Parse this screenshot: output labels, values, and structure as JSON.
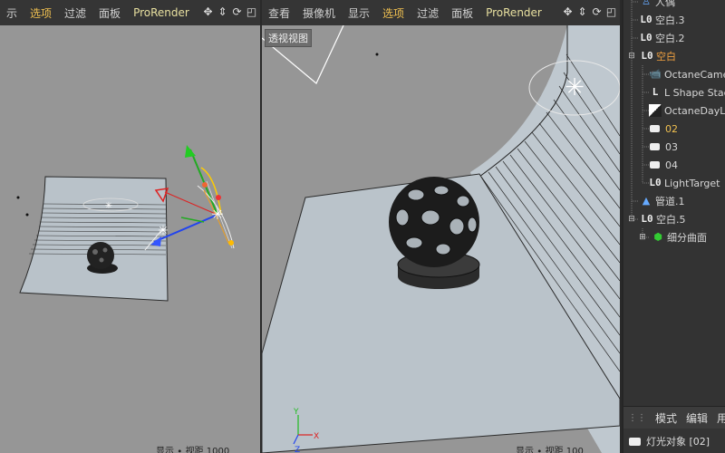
{
  "left_viewport": {
    "menu": [
      {
        "label": "示",
        "active": false
      },
      {
        "label": "选项",
        "active": true
      },
      {
        "label": "过滤",
        "active": false
      },
      {
        "label": "面板",
        "active": false
      },
      {
        "label": "ProRender",
        "active": false
      }
    ],
    "status": "显示 ∙ 视距 1000"
  },
  "right_viewport": {
    "menu": [
      {
        "label": "查看",
        "active": false
      },
      {
        "label": "摄像机",
        "active": false
      },
      {
        "label": "显示",
        "active": false
      },
      {
        "label": "选项",
        "active": true
      },
      {
        "label": "过滤",
        "active": false
      },
      {
        "label": "面板",
        "active": false
      },
      {
        "label": "ProRender",
        "active": false
      }
    ],
    "view_label": "透视视图",
    "status": "显示 ∙ 视距 100"
  },
  "nav_icons": [
    "move-icon",
    "move-vertical-icon",
    "rotate-icon",
    "maximize-icon"
  ],
  "object_manager": {
    "items": [
      {
        "label": "人偶",
        "icon": "figure-icon",
        "indent": 1
      },
      {
        "label": "空白.3",
        "icon": "null-icon",
        "indent": 1
      },
      {
        "label": "空白.2",
        "icon": "null-icon",
        "indent": 1
      },
      {
        "label": "空白",
        "icon": "null-icon",
        "indent": 1,
        "state": "selected"
      },
      {
        "label": "OctaneCamera",
        "icon": "camera-icon",
        "indent": 2
      },
      {
        "label": "L Shape Stage",
        "icon": "null-icon",
        "indent": 2
      },
      {
        "label": "OctaneDayLight",
        "icon": "daylight-icon",
        "indent": 2
      },
      {
        "label": "02",
        "icon": "light-icon",
        "indent": 2,
        "state": "active"
      },
      {
        "label": "03",
        "icon": "light-icon",
        "indent": 2
      },
      {
        "label": "04",
        "icon": "light-icon",
        "indent": 2
      },
      {
        "label": "LightTarget",
        "icon": "null-icon",
        "indent": 2
      },
      {
        "label": "管道.1",
        "icon": "tube-icon",
        "indent": 1
      },
      {
        "label": "空白.5",
        "icon": "null-icon",
        "indent": 1
      },
      {
        "label": "细分曲面",
        "icon": "subdivision-icon",
        "indent": 2
      }
    ]
  },
  "attributes": {
    "tabs": [
      "模式",
      "编辑",
      "用户"
    ],
    "object_label": "灯光对象 [02]"
  }
}
